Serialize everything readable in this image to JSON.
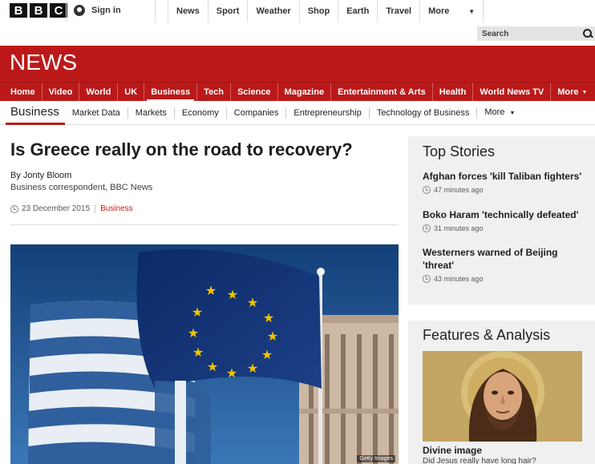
{
  "topbar": {
    "logo_letters": [
      "B",
      "B",
      "C"
    ],
    "signin_label": "Sign in",
    "nav": [
      "News",
      "Sport",
      "Weather",
      "Shop",
      "Earth",
      "Travel"
    ],
    "more_label": "More",
    "search_placeholder": "Search"
  },
  "banner": {
    "title": "NEWS"
  },
  "mainnav": {
    "items": [
      "Home",
      "Video",
      "World",
      "UK",
      "Business",
      "Tech",
      "Science",
      "Magazine",
      "Entertainment & Arts",
      "Health",
      "World News TV"
    ],
    "more_label": "More",
    "active": "Business"
  },
  "subnav": {
    "section": "Business",
    "items": [
      "Market Data",
      "Markets",
      "Economy",
      "Companies",
      "Entrepreneurship",
      "Technology of Business"
    ],
    "more_label": "More"
  },
  "article": {
    "headline": "Is Greece really on the road to recovery?",
    "author": "By Jonty Bloom",
    "role": "Business correspondent, BBC News",
    "date": "23 December 2015",
    "section": "Business",
    "image_credit": "Getty Images"
  },
  "sidebar": {
    "top_stories_title": "Top Stories",
    "stories": [
      {
        "title": "Afghan forces 'kill Taliban fighters'",
        "time": "47 minutes ago"
      },
      {
        "title": "Boko Haram 'technically defeated'",
        "time": "31 minutes ago"
      },
      {
        "title": "Westerners warned of Beijing 'threat'",
        "time": "43 minutes ago"
      }
    ],
    "features_title": "Features & Analysis",
    "feature": {
      "title": "Divine image",
      "subtitle": "Did Jesus really have long hair?"
    }
  },
  "colors": {
    "brand_red": "#bb1919",
    "sidebar_bg": "#f0f0f0"
  }
}
